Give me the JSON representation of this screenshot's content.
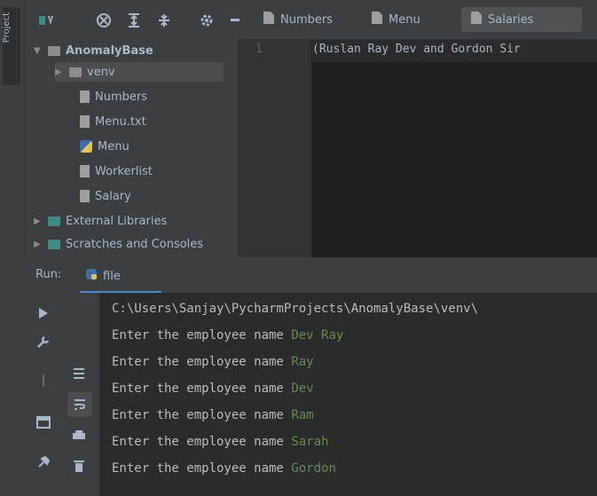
{
  "left_strip": {
    "project_label": "Project"
  },
  "toolbar": {
    "tabs": [
      {
        "label": "Numbers"
      },
      {
        "label": "Menu"
      },
      {
        "label": "Salaries"
      }
    ]
  },
  "project_tree": {
    "rows": [
      {
        "label": "AnomalyBase",
        "level": 0,
        "kind": "folder"
      },
      {
        "label": "venv",
        "level": 1,
        "kind": "folder"
      },
      {
        "label": "Numbers",
        "level": 2,
        "kind": "file"
      },
      {
        "label": "Menu.txt",
        "level": 2,
        "kind": "file"
      },
      {
        "label": "Menu",
        "level": 2,
        "kind": "py"
      },
      {
        "label": "Workerlist",
        "level": 2,
        "kind": "file"
      },
      {
        "label": "Salary",
        "level": 2,
        "kind": "file"
      },
      {
        "label": "External Libraries",
        "level": 0,
        "kind": "lib"
      },
      {
        "label": "Scratches and Consoles",
        "level": 0,
        "kind": "scratch"
      }
    ]
  },
  "editor": {
    "line_number": "1",
    "code": "(Ruslan Ray Dev and Gordon Sir"
  },
  "run_panel": {
    "run_label": "Run:",
    "tab_label": "file",
    "console": {
      "path_line": "C:\\Users\\Sanjay\\PycharmProjects\\AnomalyBase\\venv\\",
      "prompt": "Enter the employee name",
      "entries": [
        "Dev Ray",
        "Ray",
        "Dev",
        "Ram",
        "Sarah",
        "Gordon"
      ]
    }
  }
}
